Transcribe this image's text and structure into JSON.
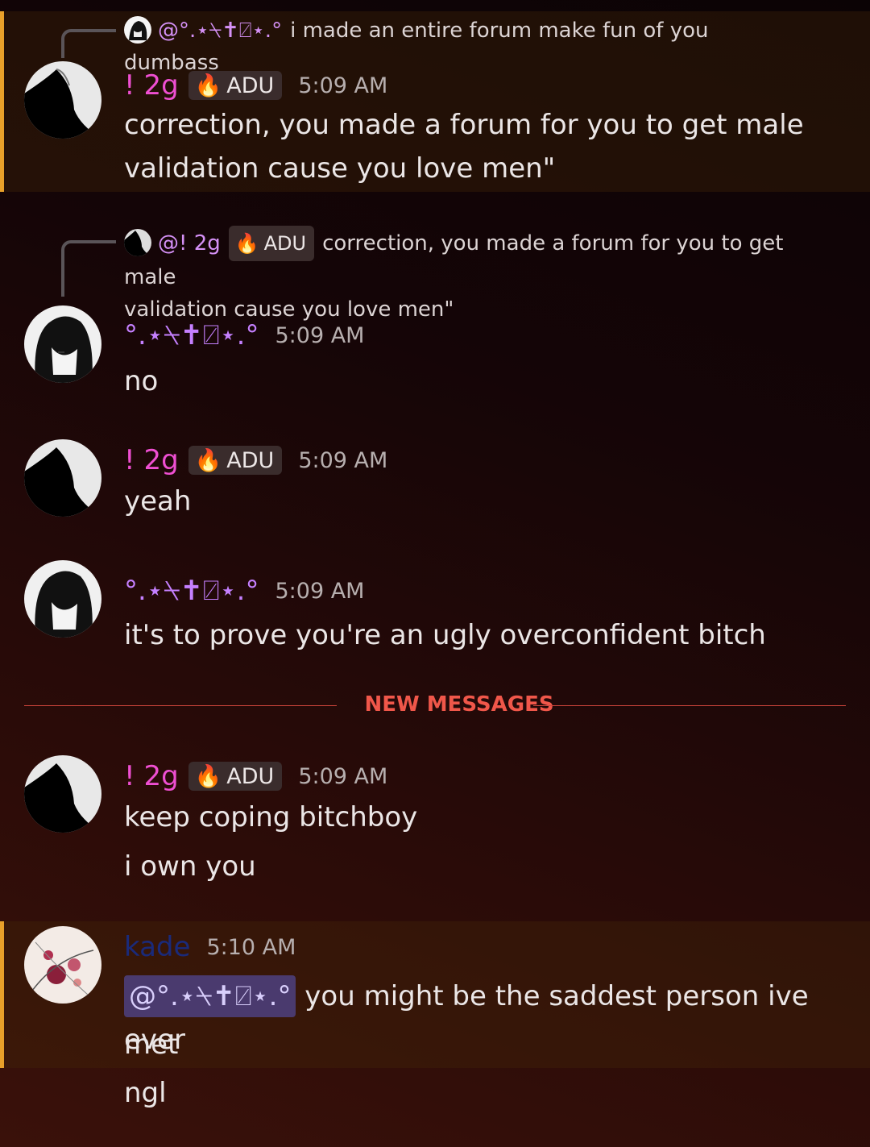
{
  "colors": {
    "accent_bar": "#e8a02a",
    "new_messages": "#f0574a",
    "mention_chip": "#4a3a6e"
  },
  "messages": [
    {
      "reply": {
        "mention": "@°.⋆⍀✝⍁⋆.°",
        "text": "i made an entire forum make fun of you dumbass"
      },
      "author": "! 2g",
      "tag": "ADU",
      "time": "5:09 AM",
      "lines": [
        "correction, you made a forum for you to get male",
        "validation cause you love men\""
      ]
    },
    {
      "reply": {
        "mention": "@! 2g",
        "tag": "ADU",
        "text": "correction, you made a forum for you to get male",
        "text2": "validation cause you love men\""
      },
      "author": "°.⋆⍀✝⍁⋆.°",
      "time": "5:09 AM",
      "lines": [
        "no"
      ]
    },
    {
      "author": "! 2g",
      "tag": "ADU",
      "time": "5:09 AM",
      "lines": [
        "yeah"
      ]
    },
    {
      "author": "°.⋆⍀✝⍁⋆.°",
      "time": "5:09 AM",
      "lines": [
        "it's to prove you're an ugly overconfident bitch"
      ]
    },
    {
      "author": "! 2g",
      "tag": "ADU",
      "time": "5:09 AM",
      "lines": [
        "keep coping bitchboy",
        "i own you"
      ]
    },
    {
      "author": "kade",
      "time": "5:10 AM",
      "mention": "@°.⋆⍀✝⍁⋆.°",
      "lines": [
        "you might be the saddest person ive ever",
        "met",
        "ngl"
      ]
    }
  ],
  "divider": {
    "label": "NEW MESSAGES"
  },
  "icons": {
    "role": "fire-icon"
  }
}
